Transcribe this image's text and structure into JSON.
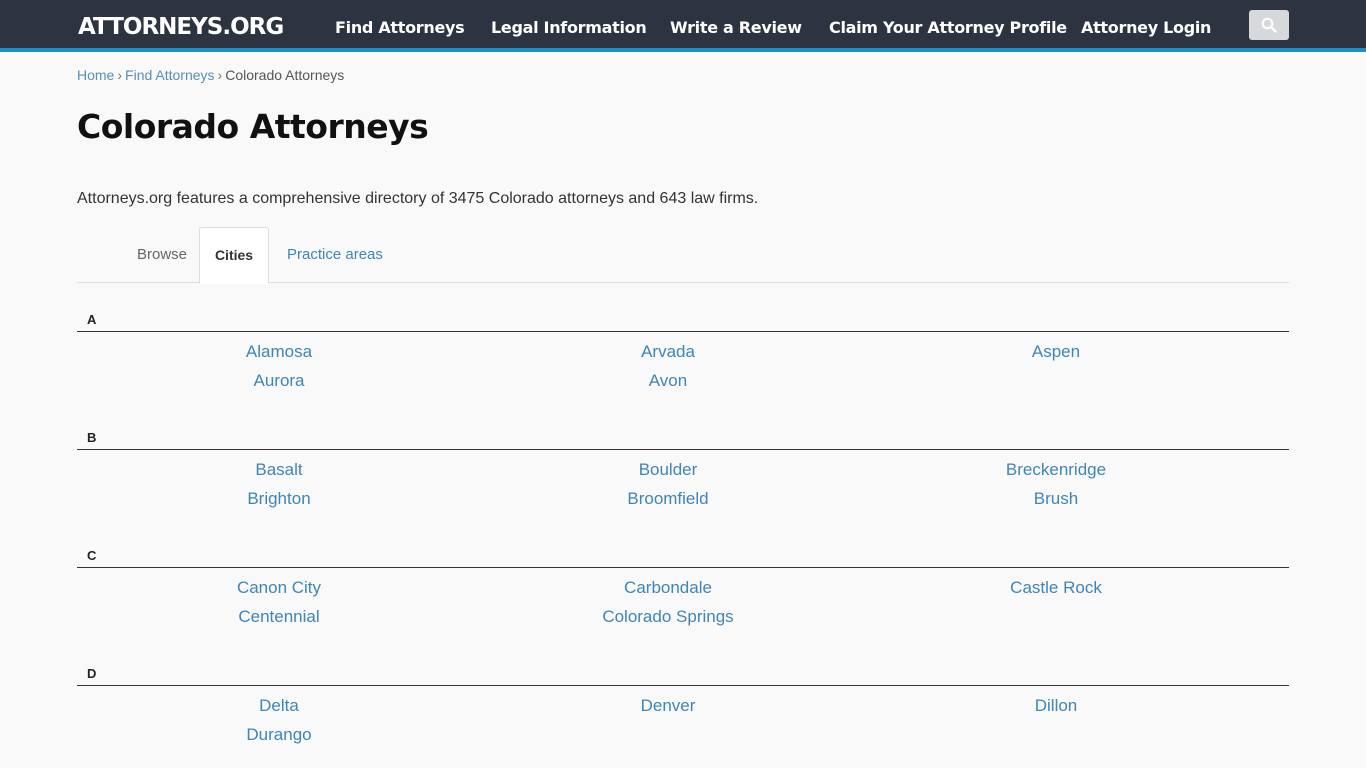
{
  "header": {
    "logo": "ATTORNEYS.ORG",
    "nav": [
      "Find Attorneys",
      "Legal Information",
      "Write a Review",
      "Claim Your Attorney Profile",
      "Attorney Login"
    ],
    "search_icon": "search-icon"
  },
  "breadcrumb": {
    "home": "Home",
    "find": "Find Attorneys",
    "current": "Colorado Attorneys",
    "separator": "›"
  },
  "page": {
    "title": "Colorado Attorneys",
    "intro": "Attorneys.org features a comprehensive directory of 3475 Colorado attorneys and 643 law firms."
  },
  "tabs": {
    "browse": "Browse",
    "cities": "Cities",
    "practice": "Practice areas"
  },
  "sections": [
    {
      "letter": "A",
      "cities": [
        "Alamosa",
        "Arvada",
        "Aspen",
        "Aurora",
        "Avon"
      ]
    },
    {
      "letter": "B",
      "cities": [
        "Basalt",
        "Boulder",
        "Breckenridge",
        "Brighton",
        "Broomfield",
        "Brush"
      ]
    },
    {
      "letter": "C",
      "cities": [
        "Canon City",
        "Carbondale",
        "Castle Rock",
        "Centennial",
        "Colorado Springs"
      ]
    },
    {
      "letter": "D",
      "cities": [
        "Delta",
        "Denver",
        "Dillon",
        "Durango"
      ]
    }
  ]
}
